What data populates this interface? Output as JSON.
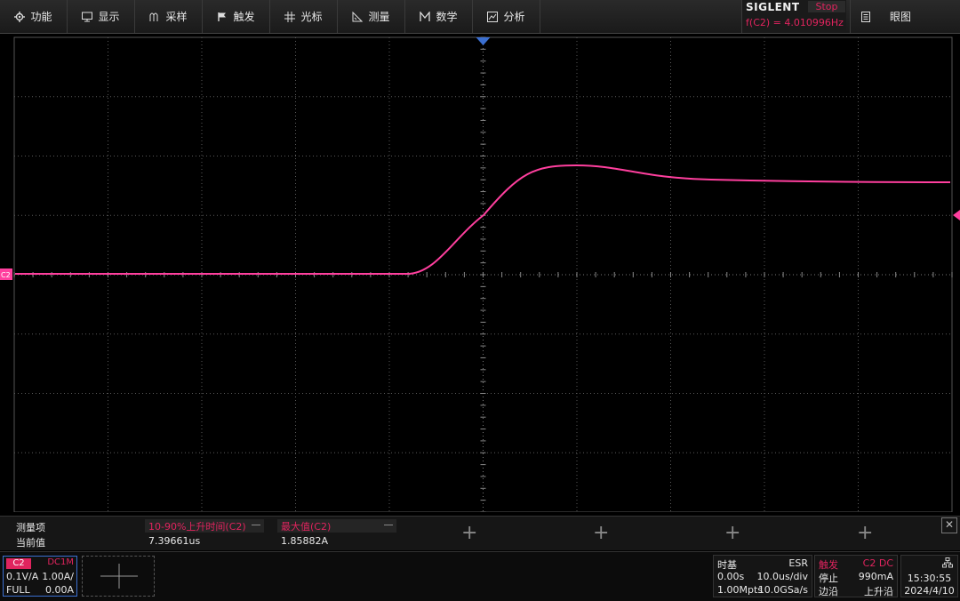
{
  "menu": {
    "items": [
      {
        "label": "功能",
        "icon": "gear-icon"
      },
      {
        "label": "显示",
        "icon": "monitor-icon"
      },
      {
        "label": "采样",
        "icon": "sampling-icon"
      },
      {
        "label": "触发",
        "icon": "flag-icon"
      },
      {
        "label": "光标",
        "icon": "cursor-grid-icon"
      },
      {
        "label": "测量",
        "icon": "ruler-icon"
      },
      {
        "label": "数学",
        "icon": "math-icon"
      },
      {
        "label": "分析",
        "icon": "analysis-icon"
      }
    ],
    "brand": "SIGLENT",
    "run_status": "Stop",
    "frequency_readout": "f(C2) = 4.010996Hz",
    "eye_label": "眼图"
  },
  "screen": {
    "channel_marker": "C2",
    "colors": {
      "trace": "#ff3f9e",
      "accent": "#e0245e",
      "trigger": "#3b6fd0"
    }
  },
  "measurement": {
    "row_label_1": "测量项",
    "row_label_2": "当前值",
    "items": [
      {
        "name": "10-90%上升时间(C2)",
        "value": "7.39661us"
      },
      {
        "name": "最大值(C2)",
        "value": "1.85882A"
      }
    ],
    "close_glyph": "✕"
  },
  "channel": {
    "name": "C2",
    "coupling": "DC1M",
    "scale": "0.1V/A",
    "vdiv": "1.00A/",
    "bandwidth": "FULL",
    "offset": "0.00A"
  },
  "timebase": {
    "title": "时基",
    "mode": "ESR",
    "delay": "0.00s",
    "tdiv": "10.0us/div",
    "memory": "1.00Mpts",
    "sample_rate": "10.0GSa/s"
  },
  "trigger": {
    "title": "触发",
    "source": "C2 DC",
    "state": "停止",
    "level": "990mA",
    "type": "边沿",
    "slope": "上升沿"
  },
  "clock": {
    "time": "15:30:55",
    "date": "2024/4/10",
    "icon": "network-icon"
  }
}
